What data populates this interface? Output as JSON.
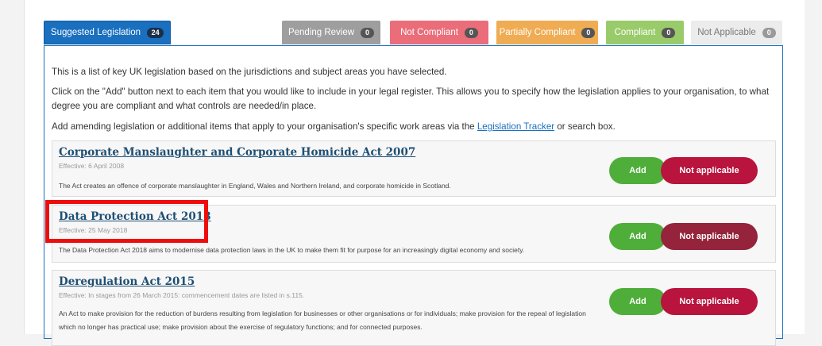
{
  "tabs": {
    "suggested": {
      "label": "Suggested Legislation",
      "count": "24"
    },
    "pending": {
      "label": "Pending Review",
      "count": "0"
    },
    "not_compliant": {
      "label": "Not Compliant",
      "count": "0"
    },
    "partially_compliant": {
      "label": "Partially Compliant",
      "count": "0"
    },
    "compliant": {
      "label": "Compliant",
      "count": "0"
    },
    "not_applicable": {
      "label": "Not Applicable",
      "count": "0"
    }
  },
  "intro": {
    "p1": "This is a list of key UK legislation based on the jurisdictions and subject areas you have selected.",
    "p2": "Click on the \"Add\" button next to each item that you would like to include in your legal register. This allows you to specify how the legislation applies to your organisation, to what degree you are compliant and what controls are needed/in place.",
    "p3_before": "Add amending legislation or additional items that apply to your organisation's specific work areas via the ",
    "p3_link": "Legislation Tracker",
    "p3_after": " or search box."
  },
  "items": [
    {
      "title": "Corporate Manslaughter and Corporate Homicide Act 2007",
      "effective": "Effective: 6 April 2008",
      "description": "The Act creates an offence of corporate manslaughter in England, Wales and Northern Ireland, and corporate homicide in Scotland.",
      "add_label": "Add",
      "na_label": "Not applicable"
    },
    {
      "title": "Data Protection Act 2018",
      "effective": "Effective: 25 May 2018",
      "description": "The Data Protection Act 2018 aims to modernise data protection laws in the UK to make them fit for purpose for an increasingly digital economy and society.",
      "add_label": "Add",
      "na_label": "Not applicable"
    },
    {
      "title": "Deregulation Act 2015",
      "effective": "Effective: In stages from 26 March 2015: commencement dates are listed in s.115.",
      "description": "An Act to make provision for the reduction of burdens resulting from legislation for businesses or other organisations or for individuals; make provision for the repeal of legislation which no longer has practical use; make provision about the exercise of regulatory functions; and for connected purposes.",
      "add_label": "Add",
      "na_label": "Not applicable"
    }
  ],
  "colors": {
    "primary": "#1a6fbe",
    "add": "#4fae3a",
    "not_applicable": "#b8143e",
    "highlight": "#ee0d0d"
  }
}
